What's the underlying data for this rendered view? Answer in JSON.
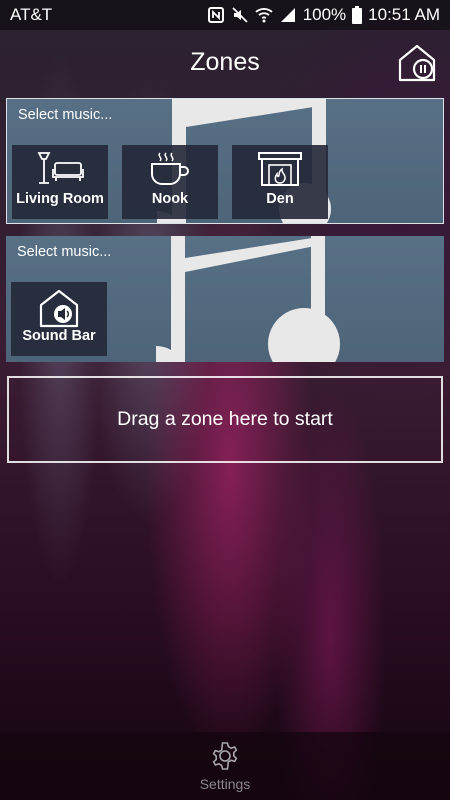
{
  "statusbar": {
    "carrier": "AT&T",
    "battery": "100%",
    "time": "10:51 AM"
  },
  "header": {
    "title": "Zones"
  },
  "groups": [
    {
      "select_label": "Select music...",
      "zones": [
        {
          "label": "Living Room",
          "icon": "couch-lamp-icon"
        },
        {
          "label": "Nook",
          "icon": "coffee-cup-icon"
        },
        {
          "label": "Den",
          "icon": "fireplace-icon"
        }
      ]
    },
    {
      "select_label": "Select music...",
      "zones": [
        {
          "label": "Sound Bar",
          "icon": "home-speaker-icon"
        }
      ]
    }
  ],
  "dropzone": {
    "text": "Drag a zone here to start"
  },
  "bottombar": {
    "settings_label": "Settings"
  }
}
